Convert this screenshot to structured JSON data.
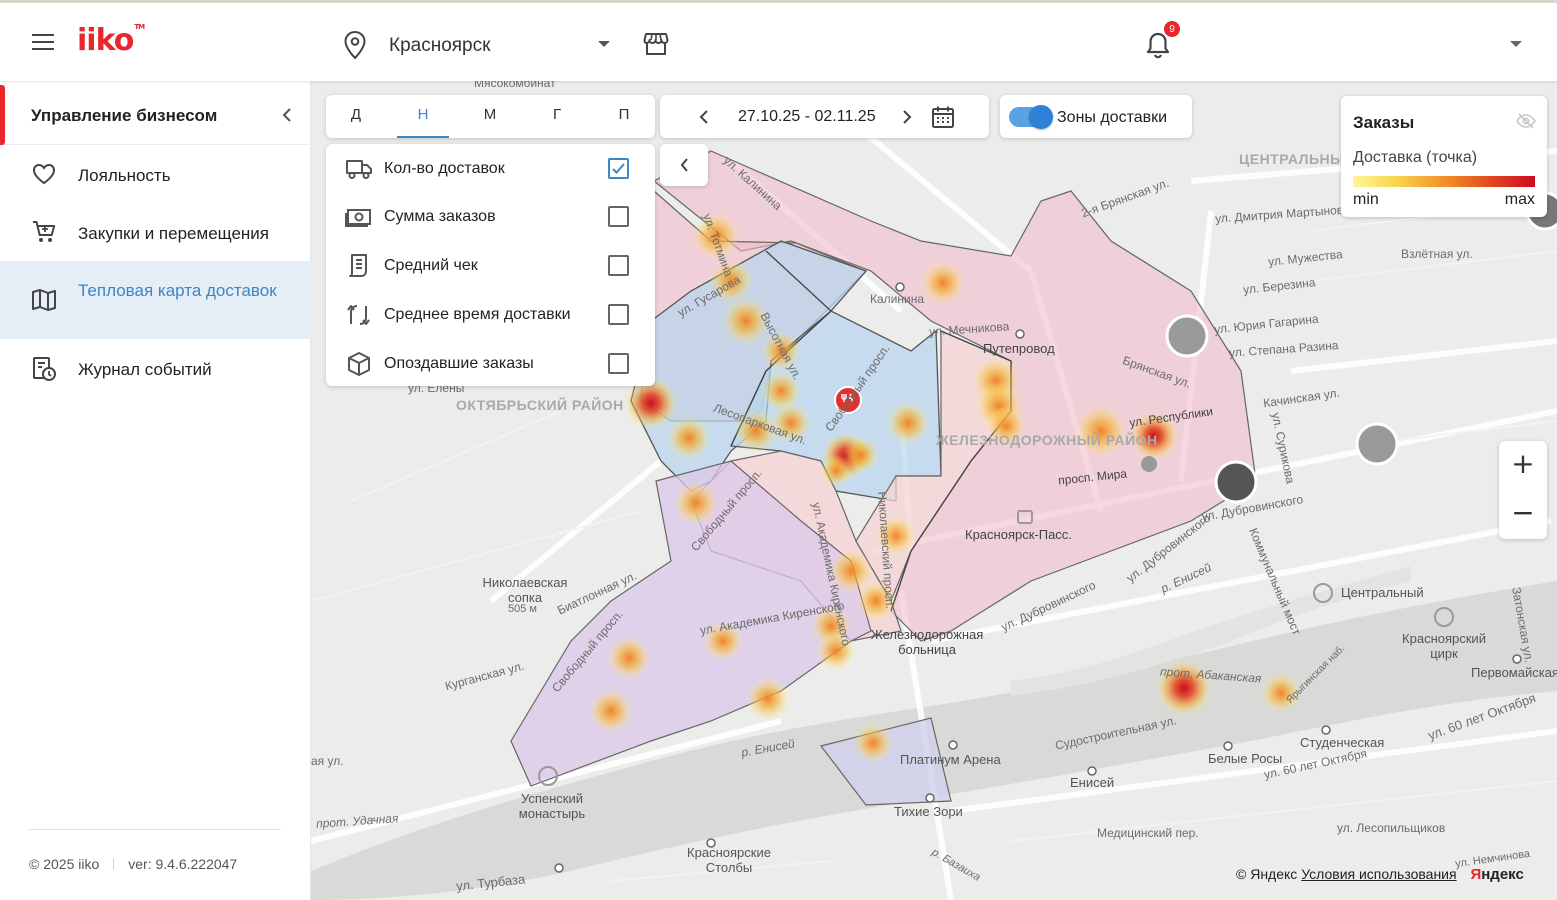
{
  "header": {
    "logo": "iiko",
    "logo_tm": "TM",
    "city": "Красноярск",
    "notifications_count": "9"
  },
  "sidebar": {
    "title": "Управление бизнесом",
    "items": [
      {
        "label": "Лояльность",
        "icon": "heart-icon"
      },
      {
        "label": "Закупки и перемещения",
        "icon": "cart-icon"
      },
      {
        "label": "Тепловая карта доставок",
        "icon": "map-icon",
        "active": true
      },
      {
        "label": "Журнал событий",
        "icon": "event-log-icon"
      }
    ],
    "copyright": "© 2025 iiko",
    "version": "ver: 9.4.6.222047"
  },
  "toolbar": {
    "periods": [
      "Д",
      "Н",
      "М",
      "Г",
      "П"
    ],
    "selected_period": "Н",
    "date_range": "27.10.25 - 02.11.25",
    "zones_label": "Зоны доставки",
    "zones_enabled": true
  },
  "metrics": [
    {
      "label": "Кол-во доставок",
      "checked": true,
      "icon": "truck-icon"
    },
    {
      "label": "Сумма заказов",
      "checked": false,
      "icon": "money-icon"
    },
    {
      "label": "Средний чек",
      "checked": false,
      "icon": "receipt-icon"
    },
    {
      "label": "Среднее время доставки",
      "checked": false,
      "icon": "delivery-time-icon"
    },
    {
      "label": "Опоздавшие заказы",
      "checked": false,
      "icon": "box-icon"
    }
  ],
  "legend": {
    "title": "Заказы",
    "subtitle": "Доставка (точка)",
    "min": "min",
    "max": "max",
    "colors": [
      "#fff69a",
      "#f7d34a",
      "#f2902c",
      "#e24a1e",
      "#cc0a22"
    ]
  },
  "map_labels": {
    "oktyabrsky": "ОКТЯБРЬСКИЙ РАЙОН",
    "zheleznodorozhny": "ЖЕЛЕЗНОДОРОЖНЫЙ РАЙОН",
    "centralny": "ЦЕНТРАЛЬНЫЙ РАЙОН",
    "myasokombinat": "Мясокомбинат",
    "kalinina_st": "ул. Калинина",
    "kalinina": "Калинина",
    "totmina": "ул. Тотмина",
    "gusarova": "ул. Гусарова",
    "vysotnaya": "Высотная ул.",
    "svobodny": "Свободный просп.",
    "lesoparkovaya": "Лесопарковая ул.",
    "eleny": "ул. Елены",
    "mechnikova": "ул. Мечникова",
    "puteprovod": "Путепровод",
    "bryanskaya": "Брянская ул.",
    "bryanskaya2": "2-я Брянская ул.",
    "martynova": "ул. Дмитрия Мартынова",
    "muzhestva": "ул. Мужества",
    "berezina": "ул. Березина",
    "gagarina": "ул. Юрия Гагарина",
    "razina": "ул. Степана Разина",
    "vzletnaya": "Взлётная ул.",
    "kachinskaya": "Качинская ул.",
    "surikova": "ул. Сурикова",
    "respubliki": "ул. Республики",
    "mira": "просп. Мира",
    "krasnoyarsk_pass": "Красноярск-Пасс.",
    "dubrovinskogo": "ул. Дубровинского",
    "dubrovinskogo2": "ул. Дубровинского",
    "kirenskogo": "ул. Академика Киренского",
    "kirenskogo2": "ул. Академика Киренского",
    "nikolaevsky": "Николаевский просп.",
    "nikolaevskaya_sopka": "Николаевская сопка",
    "sopka_height": "505 м",
    "biatlonnaya": "Биатлонная ул.",
    "kurganskaya": "Курганская ул.",
    "svobodny2": "Свободный просп.",
    "zh_bolnica": "Железнодорожная больница",
    "kommunalny_most": "Коммунальный мост",
    "centralny_poi": "Центральный",
    "eniseysk": "р. Енисей",
    "eniseysk2": "р. Енисей",
    "cirk": "Красноярский цирк",
    "pervomayskaya": "Первомайская",
    "abakanskaya": "прот. Абаканская",
    "yaryginskaya": "Ярыгинская наб.",
    "sudostroitelnaya": "Судостроительная ул.",
    "belye_rosy": "Белые Росы",
    "studencheskaya": "Студенческая",
    "let60": "ул. 60 лет Октября",
    "let60b": "ул. 60 лет Октября",
    "platinum": "Платинум Арена",
    "tihie_zori": "Тихие Зори",
    "enisey": "Енисей",
    "medicinsky": "Медицинский пер.",
    "lesopilshikov": "ул. Лесопильщиков",
    "uspensky": "Успенский монастырь",
    "udachnaya": "прот. Удачная",
    "stolby": "Красноярские Столбы",
    "turbaza": "ул. Турбаза",
    "bazaiha": "р. Базаиха",
    "zatonskaya": "Затонская ул.",
    "aya": "ая ул.",
    "nemchinov": "ул. Немчинова"
  },
  "copyright_map": "© Яндекс",
  "terms": "Условия использования",
  "yandex": "Яндекс"
}
